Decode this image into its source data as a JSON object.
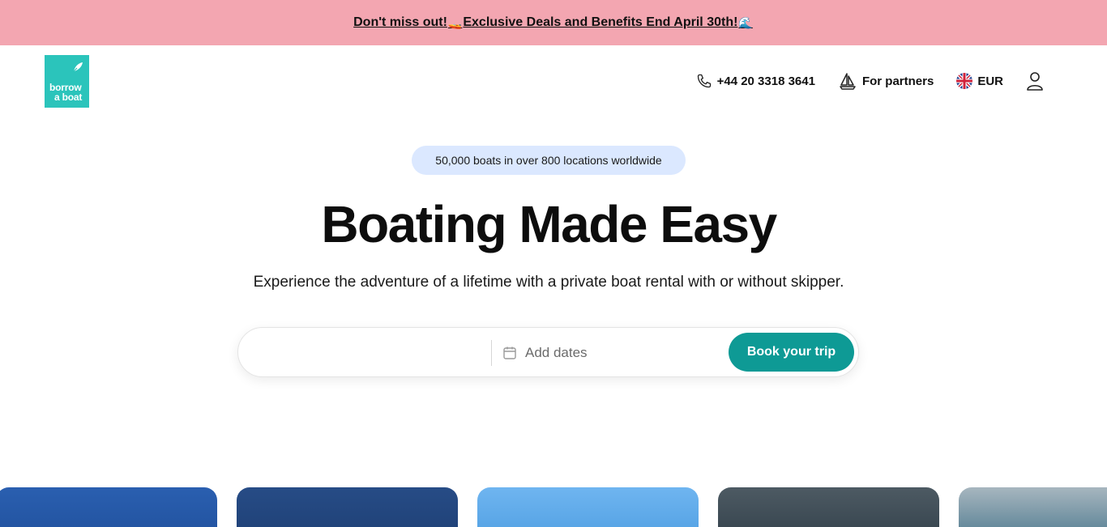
{
  "promo": {
    "text_before": "Don't miss out!",
    "text_after": "Exclusive Deals and Benefits End April 30th!",
    "emoji_1": "🚤",
    "emoji_2": "🌊"
  },
  "header": {
    "logo_line1": "borrow",
    "logo_line2": "a boat",
    "phone": "+44 20 3318 3641",
    "partners_label": "For partners",
    "currency": "EUR"
  },
  "hero": {
    "badge": "50,000 boats in over 800 locations worldwide",
    "title": "Boating Made Easy",
    "subtitle": "Experience the adventure of a lifetime with a private boat rental with or without skipper."
  },
  "search": {
    "location_value": "",
    "dates_placeholder": "Add dates",
    "button_label": "Book your trip"
  },
  "colors": {
    "promo_bg": "#f3a6b1",
    "brand_teal": "#2bc4bb",
    "button_teal": "#0e9a95",
    "badge_bg": "#dbe8ff"
  },
  "icons": [
    "phone-icon",
    "sailboat-icon",
    "uk-flag-icon",
    "user-icon",
    "calendar-icon"
  ]
}
